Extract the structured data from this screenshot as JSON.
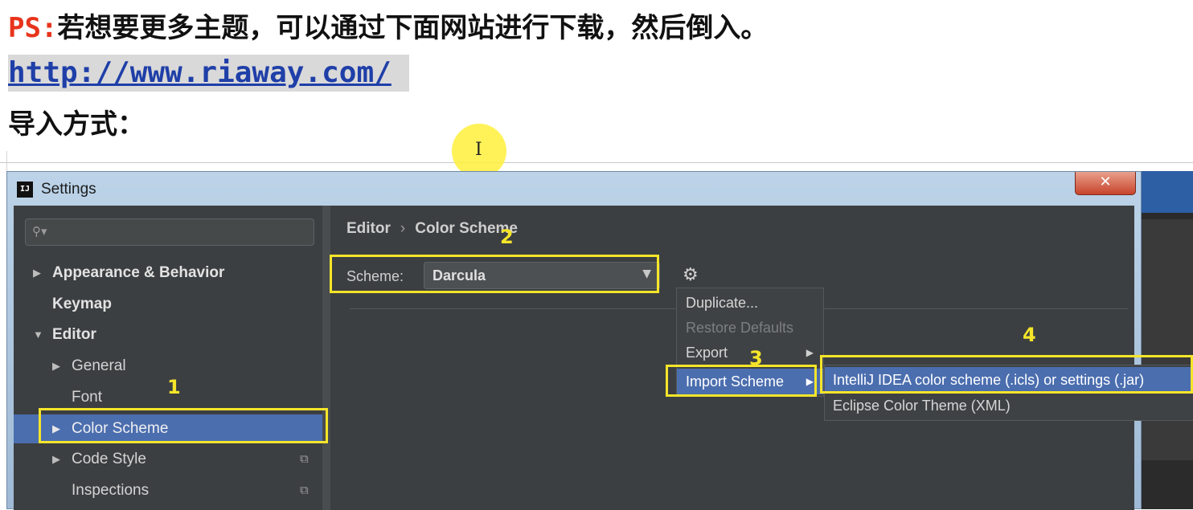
{
  "doc": {
    "ps_prefix": "PS:",
    "ps_text": "若想要更多主题，可以通过下面网站进行下载，然后倒入。",
    "link": "http://www.riaway.com/",
    "import_heading": "导入方式："
  },
  "window": {
    "title": "Settings",
    "app_icon": "IJ",
    "close_glyph": "✕"
  },
  "sidebar": {
    "search_placeholder": "",
    "items": [
      {
        "label": "Appearance & Behavior",
        "arrow": "▶"
      },
      {
        "label": "Keymap",
        "arrow": ""
      },
      {
        "label": "Editor",
        "arrow": "▼"
      },
      {
        "label": "General",
        "arrow": "▶"
      },
      {
        "label": "Font",
        "arrow": ""
      },
      {
        "label": "Color Scheme",
        "arrow": "▶",
        "selected": true
      },
      {
        "label": "Code Style",
        "arrow": "▶"
      },
      {
        "label": "Inspections",
        "arrow": ""
      }
    ]
  },
  "main": {
    "breadcrumb": [
      "Editor",
      "Color Scheme"
    ],
    "breadcrumb_sep": "›",
    "scheme_label": "Scheme:",
    "scheme_value": "Darcula"
  },
  "gear_menu": {
    "items": [
      {
        "label": "Duplicate...",
        "state": "normal"
      },
      {
        "label": "Restore Defaults",
        "state": "disabled"
      },
      {
        "label": "Export",
        "state": "normal",
        "submenu": true
      },
      {
        "label": "Import Scheme",
        "state": "highlight",
        "submenu": true
      }
    ]
  },
  "import_submenu": {
    "items": [
      {
        "label": "IntelliJ IDEA color scheme (.icls) or settings (.jar)",
        "state": "highlight"
      },
      {
        "label": "Eclipse Color Theme (XML)",
        "state": "normal"
      }
    ]
  },
  "annotations": {
    "step1": "1",
    "step2": "2",
    "step3": "3",
    "step4": "4",
    "color": "#f5e52a"
  },
  "icons": {
    "search": "search-icon",
    "gear": "gear-icon",
    "copy": "copy-icon",
    "close": "close-icon"
  },
  "colors": {
    "ps_red": "#e8341c",
    "link_blue": "#1f3fa8",
    "selection_blue": "#4b6eaf",
    "darcula_bg": "#3c3f41"
  }
}
